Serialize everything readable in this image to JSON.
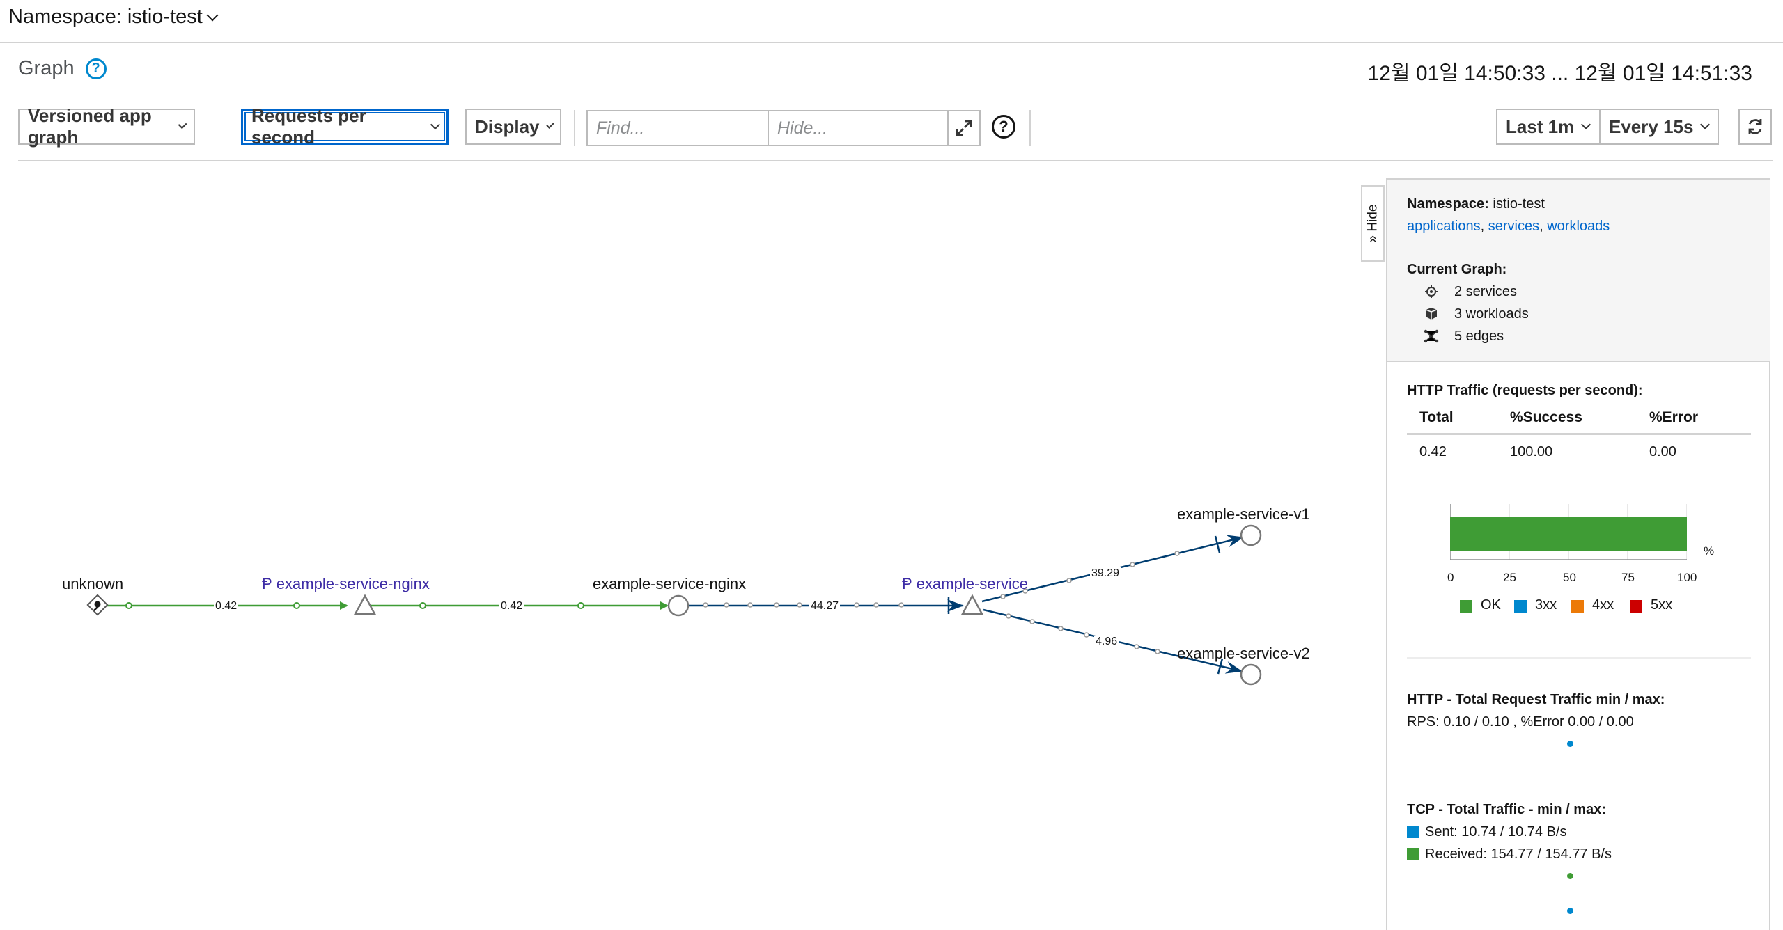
{
  "namespace_bar": {
    "label": "Namespace: istio-test"
  },
  "header": {
    "title": "Graph",
    "help": "?",
    "time_range": "12월 01일 14:50:33 ... 12월 01일 14:51:33"
  },
  "toolbar": {
    "graph_type": "Versioned app graph",
    "edge_labels": "Requests per second",
    "display": "Display",
    "find_placeholder": "Find...",
    "hide_placeholder": "Hide...",
    "help": "?",
    "duration": "Last 1m",
    "refresh_interval": "Every 15s"
  },
  "graph": {
    "nodes": {
      "unknown": "unknown",
      "nginx_app": "example-service-nginx",
      "nginx_workload": "example-service-nginx",
      "service_app": "example-service",
      "v1": "example-service-v1",
      "v2": "example-service-v2"
    },
    "edges": {
      "e1": "0.42",
      "e2": "0.42",
      "e3": "44.27",
      "e4": "39.29",
      "e5": "4.96"
    },
    "colors": {
      "healthy_edge": "#3f9c35",
      "tcp_edge": "#003d70",
      "app_label": "#3d2ca5"
    }
  },
  "panel": {
    "hide_tab": "» Hide",
    "namespace_label": "Namespace:",
    "namespace_value": "istio-test",
    "links": [
      "applications",
      "services",
      "workloads"
    ],
    "current_graph_label": "Current Graph:",
    "counts": [
      "2 services",
      "3 workloads",
      "5 edges"
    ],
    "http_traffic_title": "HTTP Traffic (requests per second):",
    "table": {
      "headers": [
        "Total",
        "%Success",
        "%Error"
      ],
      "row": [
        "0.42",
        "100.00",
        "0.00"
      ]
    },
    "bar_chart": {
      "ok_percent": 100,
      "ticks": [
        "0",
        "25",
        "50",
        "75",
        "100"
      ],
      "unit": "%",
      "legend": [
        "OK",
        "3xx",
        "4xx",
        "5xx"
      ],
      "legend_colors": [
        "#3f9c35",
        "#0088ce",
        "#ec7a08",
        "#cc0000"
      ]
    },
    "http_total_title": "HTTP - Total Request Traffic min / max:",
    "http_total_value": "RPS: 0.10 / 0.10 , %Error 0.00 / 0.00",
    "tcp_title": "TCP - Total Traffic - min / max:",
    "tcp_sent": "Sent: 10.74 / 10.74 B/s",
    "tcp_received": "Received: 154.77 / 154.77 B/s"
  }
}
